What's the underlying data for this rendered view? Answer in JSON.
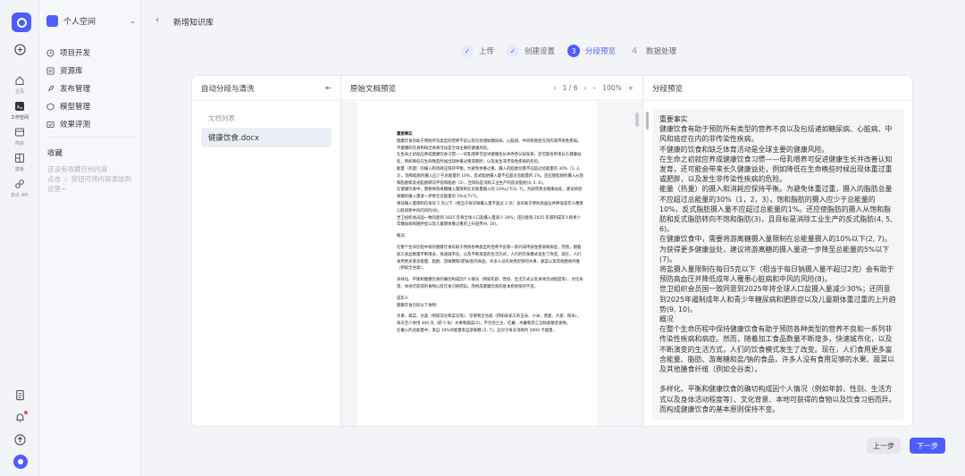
{
  "rail": {
    "items": [
      {
        "label": "主页",
        "icon": "home-icon"
      },
      {
        "label": "工作空间",
        "icon": "workspace-icon"
      },
      {
        "label": "商店",
        "icon": "store-icon"
      },
      {
        "label": "模板",
        "icon": "template-icon"
      },
      {
        "label": "扣子 API",
        "icon": "api-icon"
      }
    ]
  },
  "sidebar": {
    "workspace": "个人空间",
    "items": [
      {
        "label": "项目开发",
        "icon": "clock-icon"
      },
      {
        "label": "资源库",
        "icon": "library-icon"
      },
      {
        "label": "发布管理",
        "icon": "rocket-icon"
      },
      {
        "label": "模型管理",
        "icon": "model-icon"
      },
      {
        "label": "效果评测",
        "icon": "eval-icon"
      }
    ],
    "favorites_title": "收藏",
    "favorites_hint": "还没有收藏任何内容\n点击 ☆ 按钮可将内容添加到这里~"
  },
  "header": {
    "back": "‹",
    "title": "新增知识库"
  },
  "steps": [
    {
      "label": "上传",
      "state": "done",
      "mark": "✓"
    },
    {
      "label": "创建设置",
      "state": "done",
      "mark": "✓"
    },
    {
      "label": "分段预览",
      "state": "active",
      "mark": "3"
    },
    {
      "label": "数据处理",
      "state": "todo",
      "mark": "4"
    }
  ],
  "panel_left": {
    "title": "自动分段与清洗",
    "list_label": "文档列表",
    "doc": "健康饮食.docx"
  },
  "panel_mid": {
    "title": "原始文档预览",
    "page": "1 / 6",
    "zoom": "100%",
    "doc_lines": [
      "重要事实",
      "健康饮食有助于预防所有类型的营养不良以及包括诸如糖尿病、心脏病、中风和癌症在内的非传染性疾病。",
      "不健康的饮食和缺乏体育活动是全球主要的健康风险。",
      "在生命之初就应养成健康饮食习惯——母乳喂养可促进健康生长并改善认知发育，还可能会带来长久健康益处，例如降低在生命晚些时候出现体重过重或肥胖，以及发生非传染性疾病的危险。",
      "能量（热量）的摄入和消耗应保持平衡。为避免体重过重，摄入的脂肪总量不应超过总能量的 30%（1, 2, 3）。饱和脂肪的摄入应少于总能量的 10%，反式脂肪摄入量不应超过总能量的 1%。还应使脂肪的摄入从饱和脂肪和反式脂肪转向不饱和脂肪（3），且目标是消除工业生产的反式脂肪(4, 5, 6)。",
      "在健康饮食中，需要将游离糖摄入量限制在总能量摄入的 10%以下(2, 7)。为获得更多健康益处，建议将游离糖的摄入量进一步降至总能量的 5%以下(7)。",
      "将盐摄入量限制在每日 5 克以下（相当于每日钠摄入量不超过 2 克）会有助于预防高血压并降低成年人罹患心脏病和中风的风险(8)。",
      "世卫组织会员国一致同意到 2025 年将全球人口盐摄入量减少 30%；还同意到 2025 年遏制成年人和青少年糖尿病和肥胖症以及儿童期体重过重的上升趋势(9, 10)。",
      "概况",
      "在整个生命历程中保持健康饮食有助于预防各种类型的营养不良和一系列非传染性疾病和病症。然而，随着加工食品数量不断增多，快速城市化，以及不断演变的生活方式，人们的饮食模式发生了改变。现在，人们食用更多富含能量、脂肪、游离糖和/或钠/盐的食品，许多人没有食用足够的水果、蔬菜以及其他膳食纤维（例如全谷类）。",
      "多样化、平衡和健康饮食的确切构成因个人情况（例如年龄、性别、生活方式以及身体活动程度等）、文化背景、本地可获得的食物以及饮食习俗而异。而构成健康饮食的基本原则保持不变。",
      "成年人",
      "健康饮食包括以下食物：",
      "水果、蔬菜、豆类（例如滨豆和菜豆等）、坚果和全谷类（例如未加工的玉米、小米、燕麦、大麦、糙米）。",
      "每天至少食用 400 克（即 5 份）水果和蔬菜(2)，不包括土豆、红薯、木薯和其它淀粉类根茎食物。",
      "在摄入的总能量中，来自 10%的能量来自游离糖 (2, 7)，这对于每天消耗约 2000 卡能量，"
    ]
  },
  "panel_right": {
    "title": "分段预览",
    "lines": [
      "重要事实",
      "健康饮食有助于预防所有类型的营养不良以及包括诸如糖尿病、心脏病、中风和癌症在内的非传染性疾病。",
      "不健康的饮食和缺乏体育活动是全球主要的健康风险。",
      "在生命之初就应养成健康饮食习惯——母乳喂养可促进健康生长并改善认知发育，还可能会带来长久健康益处，例如降低在生命晚些时候出现体重过重或肥胖，以及发生非传染性疾病的危险。",
      "能量（热量）的摄入和消耗应保持平衡。为避免体重过重，摄入的脂肪总量不应超过总能量的30%（1，2，3）。饱和脂肪的摄入应少于总能量的10%，反式脂肪摄入量不应超过总能量的1%。还应使脂肪的摄入从饱和脂肪和反式脂肪转向不饱和脂肪(3)，且目标是消除工业生产的反式脂肪(4, 5, 6)。",
      "在健康饮食中，需要将游离糖摄入量限制在总能量摄入的10%以下(2, 7)。为获得更多健康益处，建议将游离糖的摄入量进一步降至总能量的5%以下(7)。",
      "将盐摄入量限制在每日5克以下（相当于每日钠摄入量不超过2克）会有助于预防高血压并降低成年人罹患心脏病和中风的风险(8)。",
      "世卫组织会员国一致同意到2025年将全球人口盐摄入量减少30%；还同意到2025年遏制成年人和青少年糖尿病和肥胖症以及儿童期体重过重的上升趋势(9, 10)。",
      "概况",
      "在整个生命历程中保持健康饮食有助于预防各种类型的营养不良和一系列非传染性疾病和病症。然而，随着加工食品数量不断增多，快速城市化，以及不断演变的生活方式，人们的饮食模式发生了改变。现在，人们食用更多富含能量、脂肪、游离糖和盐/钠的食品，许多人没有食用足够的水果、蔬菜以及其他膳食纤维（例如全谷类）。",
      "",
      "多样化、平衡和健康饮食的确切构成因个人情况（例如年龄、性别、生活方式以及身体活动程度等）、文化背景、本地可获得的食物以及饮食习俗而异。而构成健康饮食的基本原则保持不变。"
    ]
  },
  "footer": {
    "prev": "上一步",
    "next": "下一步"
  },
  "colors": {
    "accent": "#4f5dff"
  }
}
